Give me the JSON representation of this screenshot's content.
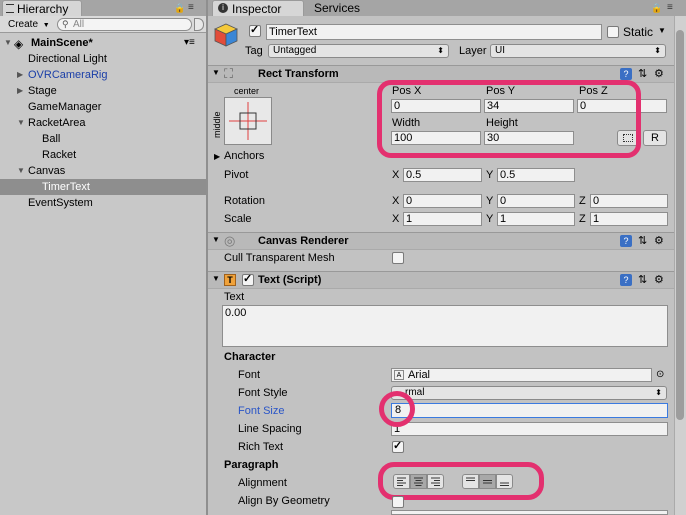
{
  "hierarchy": {
    "tab_label": "Hierarchy",
    "create_label": "Create",
    "search_placeholder": "All",
    "scene": "MainScene*",
    "items": [
      {
        "label": "Directional Light"
      },
      {
        "label": "OVRCameraRig"
      },
      {
        "label": "Stage"
      },
      {
        "label": "GameManager"
      },
      {
        "label": "RacketArea"
      },
      {
        "label": "Ball"
      },
      {
        "label": "Racket"
      },
      {
        "label": "Canvas"
      },
      {
        "label": "TimerText"
      },
      {
        "label": "EventSystem"
      }
    ]
  },
  "inspector": {
    "tabs": [
      "Inspector",
      "Services"
    ],
    "object_name": "TimerText",
    "static_label": "Static",
    "tag_label": "Tag",
    "tag_value": "Untagged",
    "layer_label": "Layer",
    "layer_value": "UI"
  },
  "rect_transform": {
    "title": "Rect Transform",
    "anchor_h": "center",
    "anchor_v": "middle",
    "posx_label": "Pos X",
    "posx": "0",
    "posy_label": "Pos Y",
    "posy": "34",
    "posz_label": "Pos Z",
    "posz": "0",
    "width_label": "Width",
    "width": "100",
    "height_label": "Height",
    "height": "30",
    "r_button": "R",
    "anchors_label": "Anchors",
    "pivot_label": "Pivot",
    "pivot_x": "0.5",
    "pivot_y": "0.5",
    "rotation_label": "Rotation",
    "rot_x": "0",
    "rot_y": "0",
    "rot_z": "0",
    "scale_label": "Scale",
    "scale_x": "1",
    "scale_y": "1",
    "scale_z": "1",
    "x": "X",
    "y": "Y",
    "z": "Z"
  },
  "canvas_renderer": {
    "title": "Canvas Renderer",
    "cull_label": "Cull Transparent Mesh"
  },
  "text_script": {
    "title": "Text (Script)",
    "text_label": "Text",
    "text_value": "0.00",
    "character_label": "Character",
    "font_label": "Font",
    "font_value": "Arial",
    "font_style_label": "Font Style",
    "font_style_value": "rmal",
    "font_size_label": "Font Size",
    "font_size_value": "8",
    "line_spacing_label": "Line Spacing",
    "line_spacing_value": "1",
    "rich_text_label": "Rich Text",
    "paragraph_label": "Paragraph",
    "alignment_label": "Alignment",
    "align_geom_label": "Align By Geometry"
  },
  "colors": {
    "highlight": "#e3306f",
    "selected_row": "#8e8e8e",
    "link_blue": "#1b3fa8",
    "font_size_label": "#2a55c7"
  }
}
